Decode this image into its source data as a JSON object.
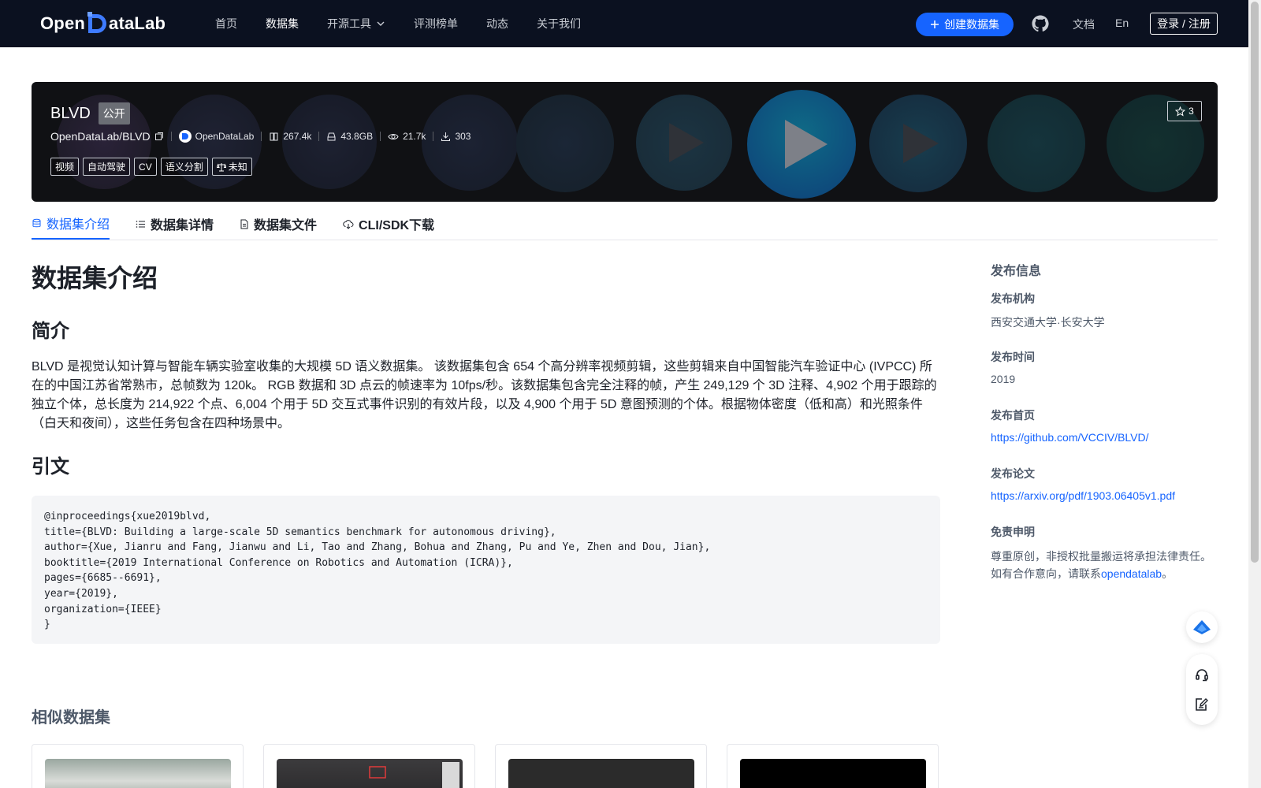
{
  "nav": {
    "logo_text_left": "Open",
    "logo_text_right": "ataLab",
    "items": [
      {
        "label": "首页",
        "active": false
      },
      {
        "label": "数据集",
        "active": true
      },
      {
        "label": "开源工具",
        "active": false,
        "dropdown": true
      },
      {
        "label": "评测榜单",
        "active": false
      },
      {
        "label": "动态",
        "active": false
      },
      {
        "label": "关于我们",
        "active": false
      }
    ],
    "create_button": "创建数据集",
    "docs": "文档",
    "lang": "En",
    "login": "登录 / 注册"
  },
  "dataset": {
    "name": "BLVD",
    "visibility": "公开",
    "path": "OpenDataLab/BLVD",
    "publisher": "OpenDataLab",
    "stats": {
      "size_files": "267.4k",
      "storage": "43.8GB",
      "views": "21.7k",
      "downloads": "303"
    },
    "tags": [
      "视频",
      "自动驾驶",
      "CV",
      "语义分割"
    ],
    "license": "未知",
    "stars": "3"
  },
  "tabs": [
    {
      "label": "数据集介绍",
      "active": true,
      "icon": "database-icon"
    },
    {
      "label": "数据集详情",
      "active": false,
      "icon": "list-icon"
    },
    {
      "label": "数据集文件",
      "active": false,
      "icon": "file-icon"
    },
    {
      "label": "CLI/SDK下载",
      "active": false,
      "icon": "cloud-download-icon"
    }
  ],
  "content": {
    "page_title": "数据集介绍",
    "intro_heading": "简介",
    "intro_text": "BLVD 是视觉认知计算与智能车辆实验室收集的大规模 5D 语义数据集。 该数据集包含 654 个高分辨率视频剪辑，这些剪辑来自中国智能汽车验证中心 (IVPCC) 所在的中国江苏省常熟市，总帧数为 120k。 RGB 数据和 3D 点云的帧速率为 10fps/秒。该数据集包含完全注释的帧，产生 249,129 个 3D 注释、4,902 个用于跟踪的独立个体，总长度为 214,922 个点、6,004 个用于 5D 交互式事件识别的有效片段，以及 4,900 个用于 5D 意图预测的个体。根据物体密度（低和高）和光照条件（白天和夜间），这些任务包含在四种场景中。",
    "citation_heading": "引文",
    "citation": "@inproceedings{xue2019blvd,\ntitle={BLVD: Building a large-scale 5D semantics benchmark for autonomous driving},\nauthor={Xue, Jianru and Fang, Jianwu and Li, Tao and Zhang, Bohua and Zhang, Pu and Ye, Zhen and Dou, Jian},\nbooktitle={2019 International Conference on Robotics and Automation (ICRA)},\npages={6685--6691},\nyear={2019},\norganization={IEEE}\n}",
    "similar_heading": "相似数据集"
  },
  "sidebar": {
    "title": "发布信息",
    "org_label": "发布机构",
    "org_value": "西安交通大学·长安大学",
    "time_label": "发布时间",
    "time_value": "2019",
    "home_label": "发布首页",
    "home_value": "https://github.com/VCCIV/BLVD/",
    "paper_label": "发布论文",
    "paper_value": "https://arxiv.org/pdf/1903.06405v1.pdf",
    "disclaimer_label": "免责申明",
    "disclaimer_line1": "尊重原创，非授权批量搬运将承担法律责任。",
    "disclaimer_line2": "如有合作意向，请联系",
    "disclaimer_link": "opendatalab",
    "disclaimer_end": "。"
  },
  "colors": {
    "nav_bg": "#0b1120",
    "accent": "#1664ff",
    "banner_bg": "#101114"
  }
}
